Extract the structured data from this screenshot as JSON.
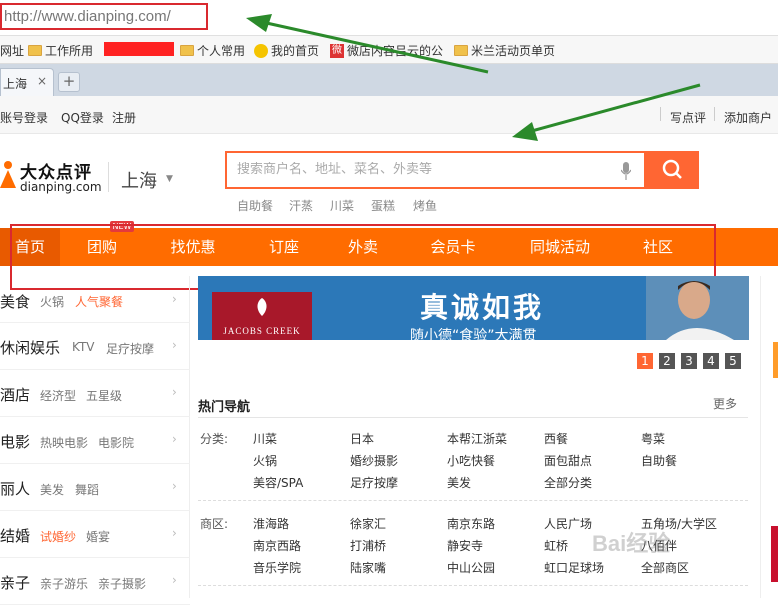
{
  "browser": {
    "url": "http://www.dianping.com/",
    "tab_title": "上海",
    "tab_close": "×",
    "new_tab": "+",
    "bookmarks": [
      "网址",
      "工作所用",
      "个人常用",
      "我的首页",
      "微店内容吕云的公",
      "米兰活动页单页"
    ]
  },
  "topbar": {
    "links": [
      "账号登录",
      "QQ登录",
      "注册"
    ],
    "right_links": [
      "写点评",
      "添加商户"
    ]
  },
  "header": {
    "logo_cn": "大众点评",
    "logo_en": "dianping.com",
    "city": "上海",
    "city_caret": "▼",
    "search_placeholder": "搜索商户名、地址、菜名、外卖等",
    "hot_searches": [
      "自助餐",
      "汗蒸",
      "川菜",
      "蛋糕",
      "烤鱼"
    ]
  },
  "nav": {
    "items": [
      "首页",
      "团购",
      "找优惠",
      "订座",
      "外卖",
      "会员卡",
      "同城活动",
      "社区"
    ],
    "new_badge": "NEW"
  },
  "categories": [
    {
      "main": "美食",
      "subs": [
        "火锅",
        "人气聚餐"
      ],
      "highlight": [
        1
      ]
    },
    {
      "main": "休闲娱乐",
      "subs": [
        "KTV",
        "足疗按摩"
      ],
      "highlight": []
    },
    {
      "main": "酒店",
      "subs": [
        "经济型",
        "五星级"
      ],
      "highlight": []
    },
    {
      "main": "电影",
      "subs": [
        "热映电影",
        "电影院"
      ],
      "highlight": []
    },
    {
      "main": "丽人",
      "subs": [
        "美发",
        "舞蹈"
      ],
      "highlight": []
    },
    {
      "main": "结婚",
      "subs": [
        "试婚纱",
        "婚宴"
      ],
      "highlight": [
        0
      ]
    },
    {
      "main": "亲子",
      "subs": [
        "亲子游乐",
        "亲子摄影"
      ],
      "highlight": []
    }
  ],
  "banner": {
    "brand": "JACOBS CREEK",
    "title": "真诚如我",
    "subtitle": "随小德“食验”大满贯",
    "pages": [
      "1",
      "2",
      "3",
      "4",
      "5"
    ]
  },
  "hot_nav": {
    "title": "热门导航",
    "more": "更多",
    "category_label": "分类:",
    "categories": [
      [
        "川菜",
        "日本",
        "本帮江浙菜",
        "西餐",
        "粤菜"
      ],
      [
        "火锅",
        "婚纱摄影",
        "小吃快餐",
        "面包甜点",
        "自助餐"
      ],
      [
        "美容/SPA",
        "足疗按摩",
        "美发",
        "全部分类"
      ]
    ],
    "district_label": "商区:",
    "districts": [
      [
        "淮海路",
        "徐家汇",
        "南京东路",
        "人民广场",
        "五角场/大学区"
      ],
      [
        "南京西路",
        "打浦桥",
        "静安寺",
        "虹桥",
        "八佰伴"
      ],
      [
        "音乐学院",
        "陆家嘴",
        "中山公园",
        "虹口足球场",
        "全部商区"
      ]
    ]
  },
  "watermark": "Bai经验"
}
